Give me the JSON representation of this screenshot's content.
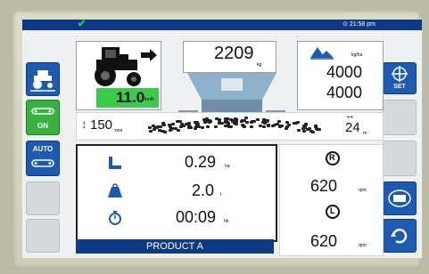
{
  "status": {
    "time": "21:58 pm"
  },
  "sidebar_left": [
    {
      "label": "",
      "icon": "tractor-icon"
    },
    {
      "label": "ON",
      "icon": "boom-icon"
    },
    {
      "label": "AUTO",
      "icon": "conveyor-icon"
    },
    {
      "label": ""
    },
    {
      "label": ""
    }
  ],
  "sidebar_right": [
    {
      "label": "SET",
      "icon": "crosshair-icon"
    },
    {
      "label": ""
    },
    {
      "label": ""
    },
    {
      "label": "",
      "icon": "spreader-icon"
    },
    {
      "label": "",
      "icon": "refresh-icon"
    }
  ],
  "speed": {
    "value": "11.0",
    "unit": "km/h"
  },
  "weight": {
    "value": "2209",
    "unit": "kg"
  },
  "rate": {
    "unit": "kg/ha",
    "target": "4000",
    "actual": "4000"
  },
  "boom": {
    "height": "150",
    "height_unit": "mm",
    "width": "24",
    "width_unit": "m"
  },
  "stats": [
    {
      "icon": "area-icon",
      "value": "0.29",
      "unit": "ha"
    },
    {
      "icon": "weight-icon",
      "value": "2.0",
      "unit": "t"
    },
    {
      "icon": "stopwatch-icon",
      "value": "00:09",
      "unit": "hh"
    }
  ],
  "discs": [
    {
      "icon": "disc-right-icon",
      "letter": "R",
      "value": "620",
      "unit": "rpm"
    },
    {
      "icon": "disc-left-icon",
      "letter": "L",
      "value": "620",
      "unit": "rpm"
    }
  ],
  "product": {
    "name": "PRODUCT A"
  },
  "colors": {
    "header_blue": "#0d3a87",
    "button_blue": "#1d5bb3",
    "green": "#3bcb4a",
    "hopper": "#8fb2cc"
  }
}
